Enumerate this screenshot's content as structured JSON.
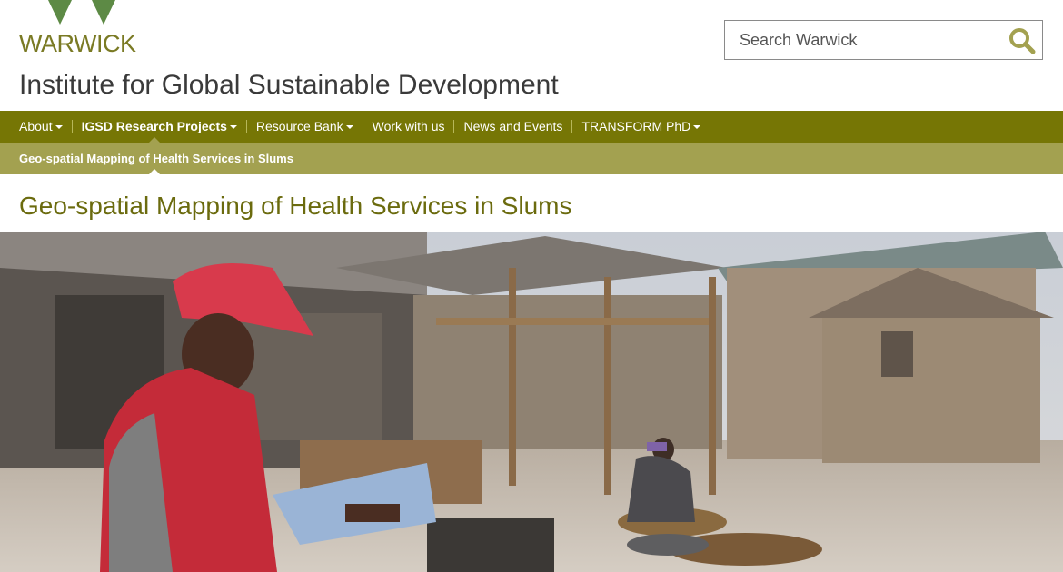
{
  "brand": {
    "logo_text": "WARWICK"
  },
  "search": {
    "placeholder": "Search Warwick"
  },
  "site": {
    "title": "Institute for Global Sustainable Development"
  },
  "nav": {
    "items": [
      {
        "label": "About",
        "dropdown": true
      },
      {
        "label": "IGSD Research Projects",
        "dropdown": true,
        "active": true
      },
      {
        "label": "Resource Bank",
        "dropdown": true
      },
      {
        "label": "Work with us",
        "dropdown": false
      },
      {
        "label": "News and Events",
        "dropdown": false
      },
      {
        "label": "TRANSFORM PhD",
        "dropdown": true
      }
    ]
  },
  "subnav": {
    "current": "Geo-spatial Mapping of Health Services in Slums"
  },
  "page": {
    "title": "Geo-spatial Mapping of Health Services in Slums"
  },
  "colors": {
    "nav": "#767605",
    "subnav": "#a3a150",
    "title": "#6b6b0e",
    "logo": "#7a7a24"
  }
}
